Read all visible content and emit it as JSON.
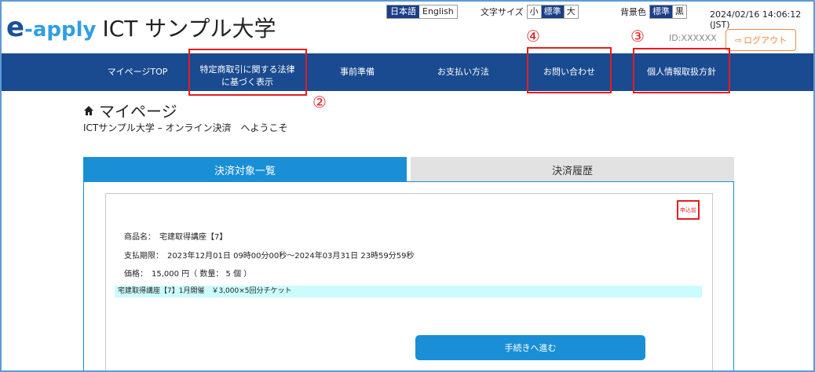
{
  "header": {
    "logo_e": "e",
    "logo_apply": "-apply",
    "logo_uni": "ICT サンプル大学",
    "lang": [
      "日本語",
      "English"
    ],
    "font_size_label": "文字サイズ",
    "font_sizes": [
      "小",
      "標準",
      "大"
    ],
    "bg_label": "背景色",
    "bg_options": [
      "標準",
      "黒"
    ],
    "datetime": "2024/02/16 14:06:12 (JST)",
    "user_id": "ID:XXXXXX",
    "logout_label": "ログアウト"
  },
  "nav": {
    "items": [
      {
        "label": "マイページTOP"
      },
      {
        "label": "特定商取引に関する法律",
        "label2": "に基づく表示"
      },
      {
        "label": "事前準備"
      },
      {
        "label": "お支払い方法"
      },
      {
        "label": "お問い合わせ"
      },
      {
        "label": "個人情報取扱方針"
      }
    ]
  },
  "annotations": {
    "n2": "②",
    "n3": "③",
    "n4": "④"
  },
  "main": {
    "page_title": "マイページ",
    "welcome": "ICTサンプル大学 – オンライン決済　へようこそ",
    "tabs": [
      {
        "label": "決済対象一覧"
      },
      {
        "label": "決済履歴"
      }
    ],
    "item": {
      "status_badge": "申込前",
      "product": "商品名：　宅建取得講座【7】",
      "period": "支払期限：　2023年12月01日 09時00分00秒～2024年03月31日 23時59分59秒",
      "price": "価格：　15,000 円（ 数量：  5 個 ）",
      "ticket": "宅建取得講座【7】1月開催　￥3,000×5回分チケット",
      "proceed_label": "手続きへ進む"
    }
  },
  "colors": {
    "nav_bg": "#1a4a8f",
    "accent": "#1a8fd6",
    "annotation": "#e41e1e",
    "logout": "#f08a3c"
  }
}
